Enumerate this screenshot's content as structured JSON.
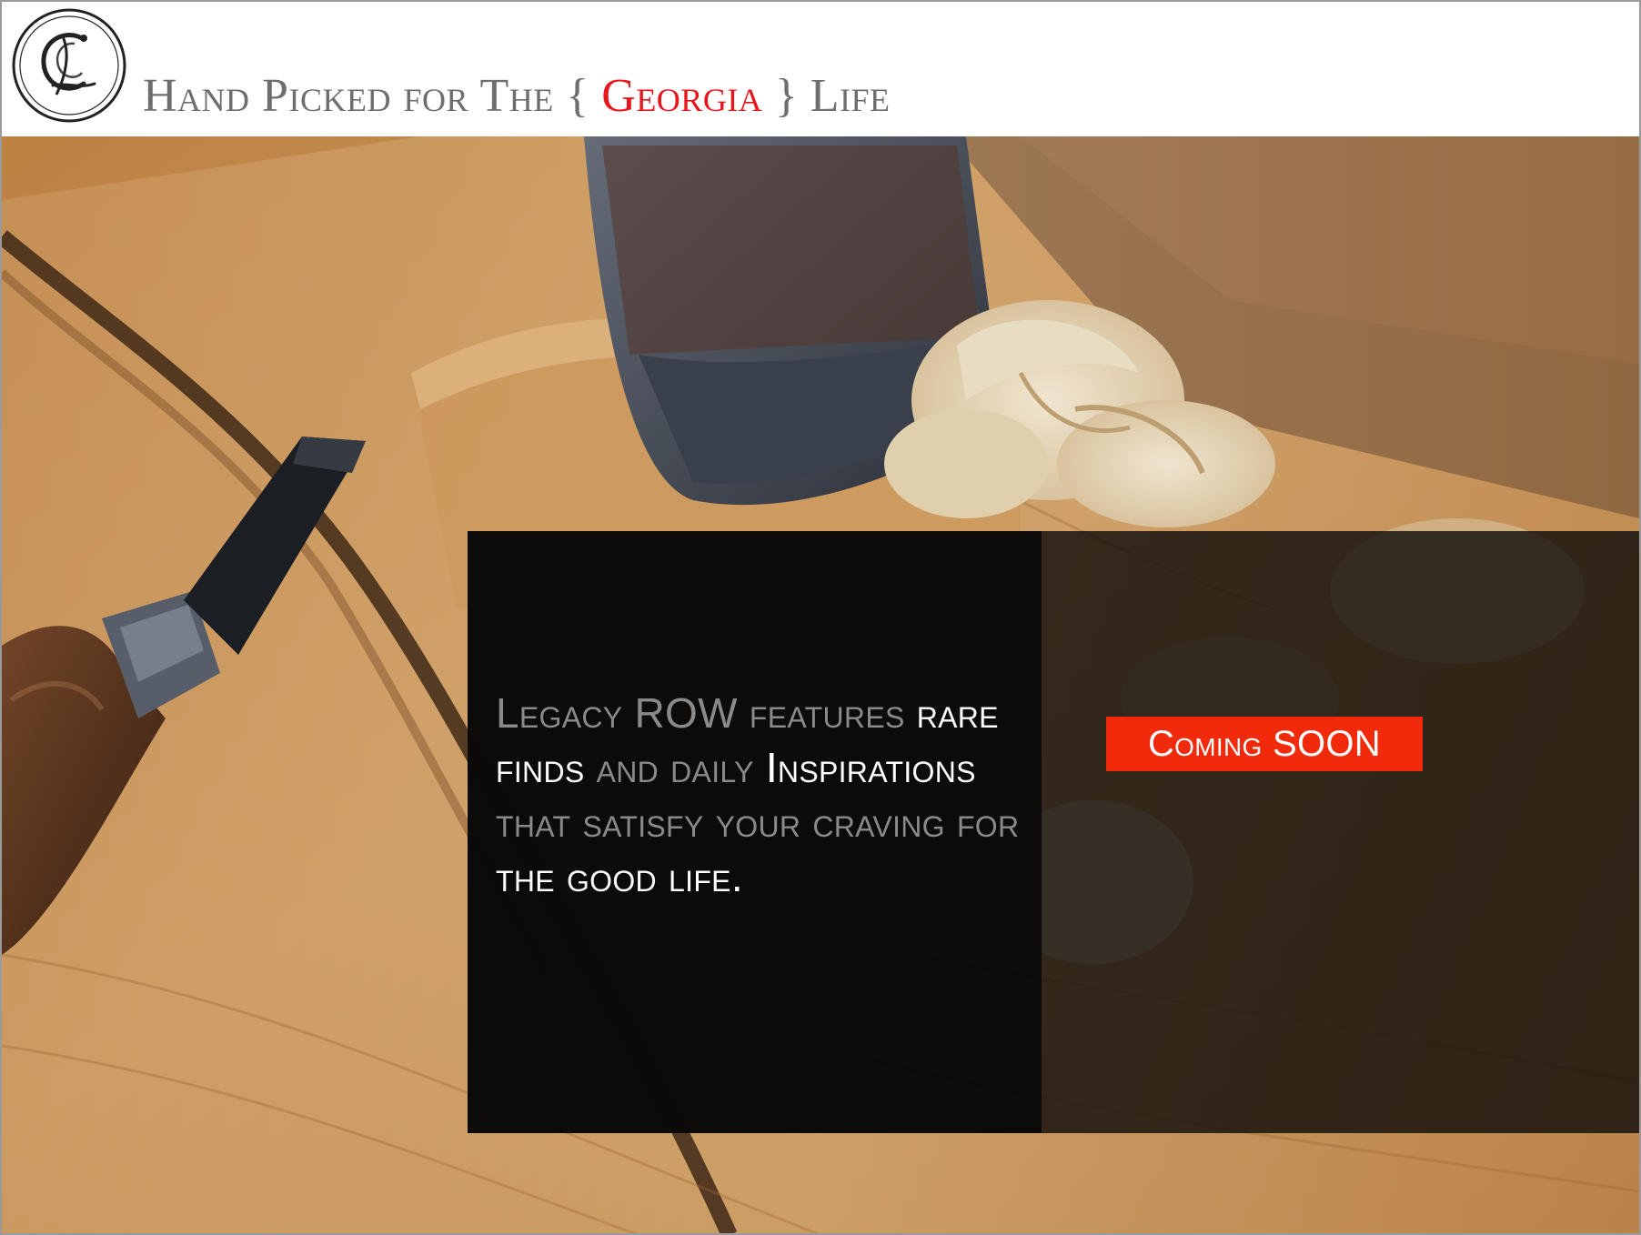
{
  "header": {
    "tagline_before": "Hand Picked for The",
    "brace_open": "{",
    "tagline_accent": "Georgia",
    "brace_close": "}",
    "tagline_after": "Life",
    "accent_color": "#e8151b",
    "logo_icon": "monogram-seal-icon"
  },
  "hero": {
    "background_description_icon": "woodworking-tools-photo",
    "blurb": {
      "p1": "Legacy ROW features",
      "p2": "rare finds",
      "p3": "and daily",
      "p4": "Inspirations",
      "p5": "that satisfy your craving for",
      "p6": "the good life."
    },
    "cta_label": "Coming SOON",
    "cta_color": "#f22a0c"
  }
}
